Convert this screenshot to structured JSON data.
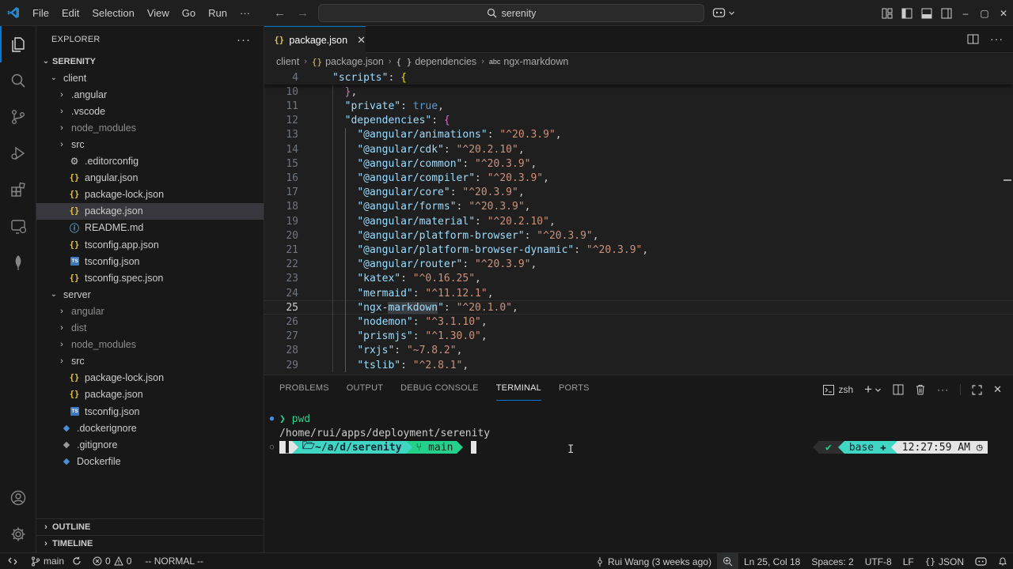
{
  "titlebar": {
    "menu": [
      "File",
      "Edit",
      "Selection",
      "View",
      "Go",
      "Run"
    ],
    "more": "···",
    "search_text": "serenity",
    "window_controls": [
      "–",
      "▢",
      "✕"
    ]
  },
  "explorer": {
    "title": "EXPLORER",
    "more": "···",
    "root": "SERENITY",
    "tree": [
      {
        "depth": 1,
        "type": "folder-open",
        "label": "client"
      },
      {
        "depth": 2,
        "type": "folder",
        "label": ".angular"
      },
      {
        "depth": 2,
        "type": "folder",
        "label": ".vscode"
      },
      {
        "depth": 2,
        "type": "folder",
        "label": "node_modules",
        "dimmed": true
      },
      {
        "depth": 2,
        "type": "folder",
        "label": "src"
      },
      {
        "depth": 2,
        "type": "gear",
        "label": ".editorconfig"
      },
      {
        "depth": 2,
        "type": "json",
        "label": "angular.json"
      },
      {
        "depth": 2,
        "type": "json",
        "label": "package-lock.json"
      },
      {
        "depth": 2,
        "type": "json",
        "label": "package.json",
        "selected": true
      },
      {
        "depth": 2,
        "type": "md",
        "label": "README.md"
      },
      {
        "depth": 2,
        "type": "json",
        "label": "tsconfig.app.json"
      },
      {
        "depth": 2,
        "type": "ts",
        "label": "tsconfig.json"
      },
      {
        "depth": 2,
        "type": "json",
        "label": "tsconfig.spec.json"
      },
      {
        "depth": 1,
        "type": "folder-open",
        "label": "server"
      },
      {
        "depth": 2,
        "type": "folder",
        "label": "angular",
        "dimmed": true
      },
      {
        "depth": 2,
        "type": "folder",
        "label": "dist",
        "dimmed": true
      },
      {
        "depth": 2,
        "type": "folder",
        "label": "node_modules",
        "dimmed": true
      },
      {
        "depth": 2,
        "type": "folder",
        "label": "src"
      },
      {
        "depth": 2,
        "type": "json",
        "label": "package-lock.json"
      },
      {
        "depth": 2,
        "type": "json",
        "label": "package.json"
      },
      {
        "depth": 2,
        "type": "ts",
        "label": "tsconfig.json"
      },
      {
        "depth": 1,
        "type": "docker",
        "label": ".dockerignore"
      },
      {
        "depth": 1,
        "type": "git",
        "label": ".gitignore"
      },
      {
        "depth": 1,
        "type": "docker",
        "label": "Dockerfile"
      }
    ],
    "outline": "OUTLINE",
    "timeline": "TIMELINE"
  },
  "editor": {
    "tab_label": "package.json",
    "tab_icon": "{}",
    "breadcrumb": {
      "folder": "client",
      "file": "package.json",
      "obj": "dependencies",
      "key": "ngx-markdown",
      "json_glyph": "{}",
      "obj_glyph": "{ }",
      "key_glyph": "abc"
    },
    "sticky_line": {
      "num": "4",
      "key": "\"scripts\"",
      "rest": ": {"
    },
    "lines": [
      {
        "num": "10",
        "parts": [
          [
            "p",
            "  "
          ],
          [
            "b2",
            "}"
          ],
          [
            "p",
            ","
          ]
        ]
      },
      {
        "num": "11",
        "parts": [
          [
            "p",
            "  "
          ],
          [
            "k",
            "\"private\""
          ],
          [
            "p",
            ": "
          ],
          [
            "bool",
            "true"
          ],
          [
            "p",
            ","
          ]
        ]
      },
      {
        "num": "12",
        "parts": [
          [
            "p",
            "  "
          ],
          [
            "k",
            "\"dependencies\""
          ],
          [
            "p",
            ": "
          ],
          [
            "b2",
            "{"
          ]
        ]
      },
      {
        "num": "13",
        "parts": [
          [
            "p",
            "    "
          ],
          [
            "k",
            "\"@angular/animations\""
          ],
          [
            "p",
            ": "
          ],
          [
            "s",
            "\"^20.3.9\""
          ],
          [
            "p",
            ","
          ]
        ]
      },
      {
        "num": "14",
        "parts": [
          [
            "p",
            "    "
          ],
          [
            "k",
            "\"@angular/cdk\""
          ],
          [
            "p",
            ": "
          ],
          [
            "s",
            "\"^20.2.10\""
          ],
          [
            "p",
            ","
          ]
        ]
      },
      {
        "num": "15",
        "parts": [
          [
            "p",
            "    "
          ],
          [
            "k",
            "\"@angular/common\""
          ],
          [
            "p",
            ": "
          ],
          [
            "s",
            "\"^20.3.9\""
          ],
          [
            "p",
            ","
          ]
        ]
      },
      {
        "num": "16",
        "parts": [
          [
            "p",
            "    "
          ],
          [
            "k",
            "\"@angular/compiler\""
          ],
          [
            "p",
            ": "
          ],
          [
            "s",
            "\"^20.3.9\""
          ],
          [
            "p",
            ","
          ]
        ]
      },
      {
        "num": "17",
        "parts": [
          [
            "p",
            "    "
          ],
          [
            "k",
            "\"@angular/core\""
          ],
          [
            "p",
            ": "
          ],
          [
            "s",
            "\"^20.3.9\""
          ],
          [
            "p",
            ","
          ]
        ]
      },
      {
        "num": "18",
        "parts": [
          [
            "p",
            "    "
          ],
          [
            "k",
            "\"@angular/forms\""
          ],
          [
            "p",
            ": "
          ],
          [
            "s",
            "\"^20.3.9\""
          ],
          [
            "p",
            ","
          ]
        ]
      },
      {
        "num": "19",
        "parts": [
          [
            "p",
            "    "
          ],
          [
            "k",
            "\"@angular/material\""
          ],
          [
            "p",
            ": "
          ],
          [
            "s",
            "\"^20.2.10\""
          ],
          [
            "p",
            ","
          ]
        ]
      },
      {
        "num": "20",
        "parts": [
          [
            "p",
            "    "
          ],
          [
            "k",
            "\"@angular/platform-browser\""
          ],
          [
            "p",
            ": "
          ],
          [
            "s",
            "\"^20.3.9\""
          ],
          [
            "p",
            ","
          ]
        ]
      },
      {
        "num": "21",
        "parts": [
          [
            "p",
            "    "
          ],
          [
            "k",
            "\"@angular/platform-browser-dynamic\""
          ],
          [
            "p",
            ": "
          ],
          [
            "s",
            "\"^20.3.9\""
          ],
          [
            "p",
            ","
          ]
        ]
      },
      {
        "num": "22",
        "parts": [
          [
            "p",
            "    "
          ],
          [
            "k",
            "\"@angular/router\""
          ],
          [
            "p",
            ": "
          ],
          [
            "s",
            "\"^20.3.9\""
          ],
          [
            "p",
            ","
          ]
        ]
      },
      {
        "num": "23",
        "parts": [
          [
            "p",
            "    "
          ],
          [
            "k",
            "\"katex\""
          ],
          [
            "p",
            ": "
          ],
          [
            "s",
            "\"^0.16.25\""
          ],
          [
            "p",
            ","
          ]
        ]
      },
      {
        "num": "24",
        "parts": [
          [
            "p",
            "    "
          ],
          [
            "k",
            "\"mermaid\""
          ],
          [
            "p",
            ": "
          ],
          [
            "s",
            "\"^11.12.1\""
          ],
          [
            "p",
            ","
          ]
        ]
      },
      {
        "num": "25",
        "current": true,
        "parts": [
          [
            "p",
            "    "
          ],
          [
            "k",
            "\"ngx-"
          ],
          [
            "k hl",
            "markdown"
          ],
          [
            "k",
            "\""
          ],
          [
            "p",
            ": "
          ],
          [
            "s",
            "\"^20.1.0\""
          ],
          [
            "p",
            ","
          ]
        ]
      },
      {
        "num": "26",
        "parts": [
          [
            "p",
            "    "
          ],
          [
            "k",
            "\"nodemon\""
          ],
          [
            "p",
            ": "
          ],
          [
            "s",
            "\"^3.1.10\""
          ],
          [
            "p",
            ","
          ]
        ]
      },
      {
        "num": "27",
        "parts": [
          [
            "p",
            "    "
          ],
          [
            "k",
            "\"prismjs\""
          ],
          [
            "p",
            ": "
          ],
          [
            "s",
            "\"^1.30.0\""
          ],
          [
            "p",
            ","
          ]
        ]
      },
      {
        "num": "28",
        "parts": [
          [
            "p",
            "    "
          ],
          [
            "k",
            "\"rxjs\""
          ],
          [
            "p",
            ": "
          ],
          [
            "s",
            "\"~7.8.2\""
          ],
          [
            "p",
            ","
          ]
        ]
      },
      {
        "num": "29",
        "parts": [
          [
            "p",
            "    "
          ],
          [
            "k",
            "\"tslib\""
          ],
          [
            "p",
            ": "
          ],
          [
            "s",
            "\"^2.8.1\""
          ],
          [
            "p",
            ","
          ]
        ]
      }
    ]
  },
  "panel": {
    "tabs": [
      "PROBLEMS",
      "OUTPUT",
      "DEBUG CONSOLE",
      "TERMINAL",
      "PORTS"
    ],
    "active_tab": "TERMINAL",
    "shell_name": "zsh",
    "terminal": {
      "prompt_symbol": "❯",
      "command": "pwd",
      "output": "/home/rui/apps/deployment/serenity",
      "path_segment": "~/a/d/serenity",
      "branch": "main",
      "check": "✔",
      "env": "base",
      "clock": "12:27:59 AM"
    }
  },
  "statusbar": {
    "branch": "main",
    "errors": "0",
    "warnings": "0",
    "mode": "-- NORMAL --",
    "blame": "Rui Wang (3 weeks ago)",
    "position": "Ln 25, Col 18",
    "spaces": "Spaces: 2",
    "encoding": "UTF-8",
    "eol": "LF",
    "language_glyph": "{}",
    "language": "JSON"
  },
  "colors": {
    "accent": "#0078d4",
    "terminal_green": "#23d18b",
    "terminal_teal": "#3fd7c3",
    "json_icon": "#e8c441"
  }
}
